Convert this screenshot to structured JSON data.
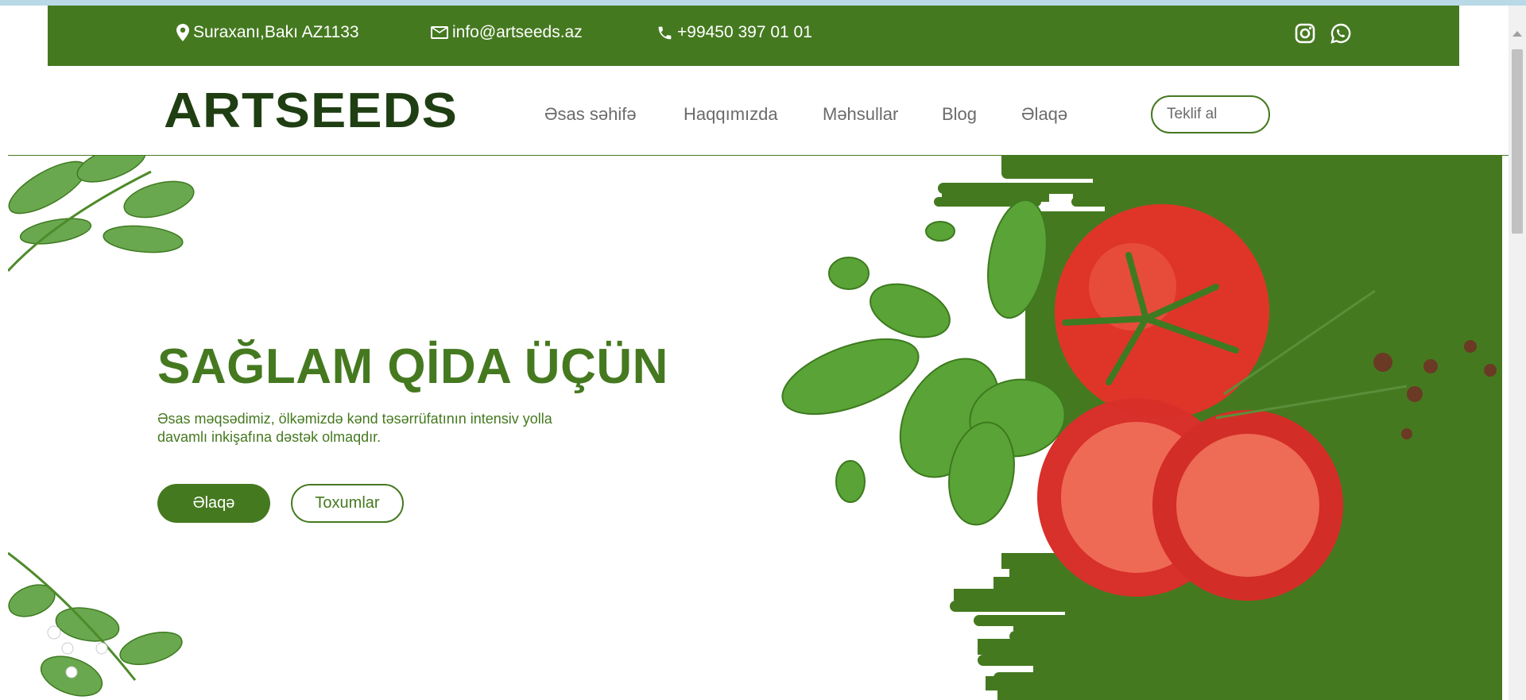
{
  "topbar": {
    "address": "Suraxanı,Bakı AZ1133",
    "email": "info@artseeds.az",
    "phone": "+99450 397 01 01",
    "social": [
      "instagram-icon",
      "whatsapp-icon"
    ]
  },
  "header": {
    "logo_text": "ARTSEEDS",
    "nav": [
      "Əsas səhifə",
      "Haqqımızda",
      "Məhsullar",
      "Blog",
      "Əlaqə"
    ],
    "quote_button": "Teklif al"
  },
  "hero": {
    "title": "SAĞLAM QİDA ÜÇÜN",
    "description": "Əsas məqsədimiz, ölkəmizdə kənd təsərrüfatının intensiv yolla davamlı inkişafına dəstək olmaqdır.",
    "primary_button": "Əlaqə",
    "secondary_button": "Toxumlar"
  },
  "colors": {
    "brand_green": "#457920",
    "dark_green": "#1f3f13",
    "tomato": "#e0352a"
  }
}
